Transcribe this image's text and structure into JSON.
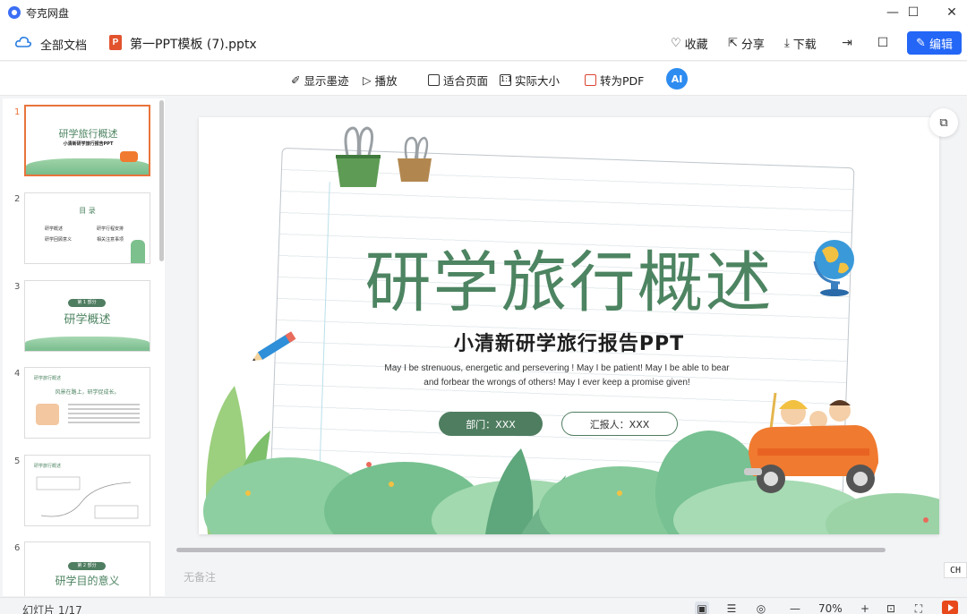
{
  "window": {
    "app_name": "夸克网盘",
    "controls": {
      "minimize": "—",
      "maximize": "☐",
      "close": "✕"
    }
  },
  "header": {
    "all_docs": "全部文档",
    "file_icon_letter": "P",
    "file_name": "第一PPT模板 (7).pptx",
    "actions": {
      "favorite": "收藏",
      "share": "分享",
      "download": "下载"
    },
    "edit": "编辑"
  },
  "toolbar": {
    "ink": "显示墨迹",
    "play": "播放",
    "fit_page": "适合页面",
    "actual_size": "实际大小",
    "to_pdf": "转为PDF",
    "ai_label": "AI"
  },
  "thumbnails": [
    {
      "num": "1",
      "title": "研学旅行概述",
      "subtitle": "小清新研学旅行报告PPT"
    },
    {
      "num": "2",
      "title": "目 录",
      "items": [
        "研学概述",
        "研学行程安排",
        "研学回顾意义",
        "相关注意事项"
      ]
    },
    {
      "num": "3",
      "badge": "第 1 部分",
      "title": "研学概述"
    },
    {
      "num": "4",
      "heading": "研学旅行概述",
      "title": "风景在路上，研学促成长。"
    },
    {
      "num": "5",
      "heading": "研学旅行概述"
    },
    {
      "num": "6",
      "badge": "第 2 部分",
      "title": "研学目的意义"
    }
  ],
  "slide": {
    "title": "研学旅行概述",
    "subtitle": "小清新研学旅行报告PPT",
    "english": "May I be strenuous, energetic and persevering ! May I be patient! May I be able to bear and forbear the wrongs of others! May I ever keep a promise given!",
    "department": "部门：XXX",
    "reporter": "汇报人：XXX"
  },
  "notes_placeholder": "无备注",
  "ime_badge": "CH",
  "status": {
    "slide_count": "幻灯片 1/17",
    "zoom": "70%",
    "zoom_minus": "—",
    "zoom_plus": "+"
  },
  "colors": {
    "accent_blue": "#2466f6",
    "slide_green": "#4d8461",
    "active_orange": "#e8743b"
  }
}
